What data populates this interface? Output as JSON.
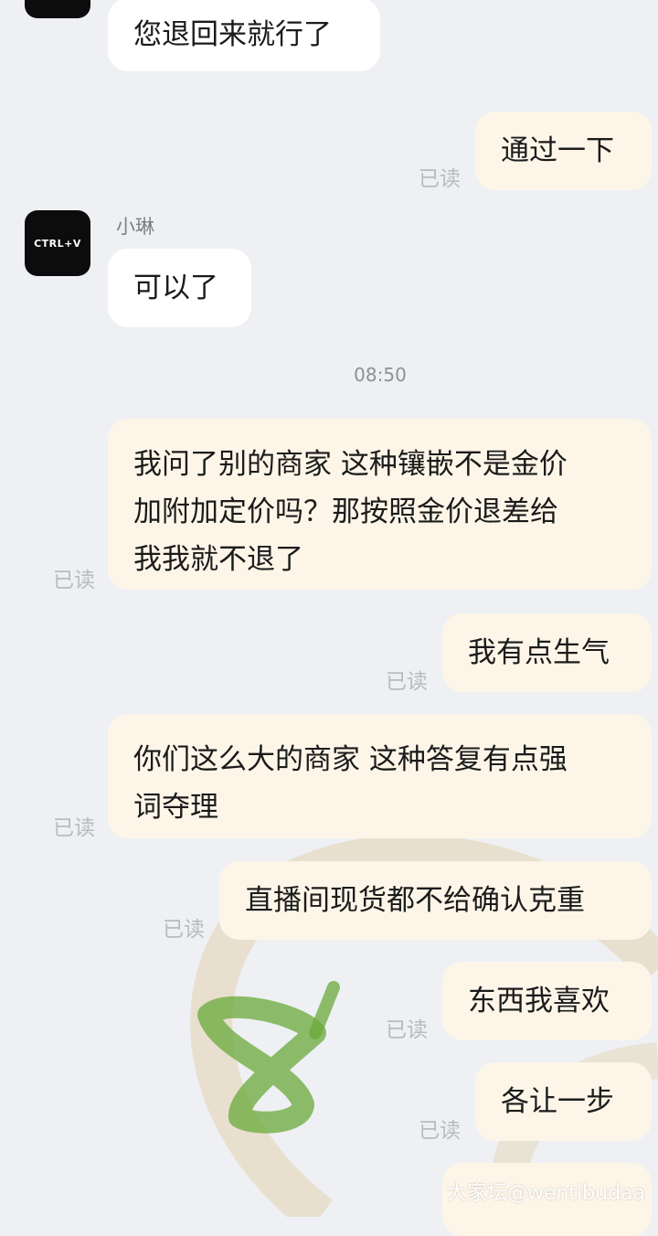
{
  "contact": {
    "name": "小琳",
    "avatar_text": "CTRL+V"
  },
  "timestamp": "08:50",
  "messages": [
    {
      "side": "in",
      "text": "您退回来就行了"
    },
    {
      "side": "out",
      "text": "通过一下",
      "status": "已读"
    },
    {
      "side": "in",
      "text": "可以了"
    },
    {
      "side": "out",
      "lines": [
        "我问了别的商家 这种镶嵌不是金价",
        "加附加定价吗？那按照金价退差给",
        "我我就不退了"
      ],
      "status": "已读"
    },
    {
      "side": "out",
      "text": "我有点生气",
      "status": "已读"
    },
    {
      "side": "out",
      "lines": [
        "你们这么大的商家 这种答复有点强",
        "词夺理"
      ],
      "status": "已读"
    },
    {
      "side": "out",
      "text": "直播间现货都不给确认克重",
      "status": "已读"
    },
    {
      "side": "out",
      "text": "东西我喜欢",
      "status": "已读"
    },
    {
      "side": "out",
      "text": "各让一步",
      "status": "已读"
    }
  ],
  "watermark": "大家坛@wentibudaa",
  "colors": {
    "background": "#eef0f3",
    "incoming_bubble": "#ffffff",
    "outgoing_bubble": "#fdf6e8",
    "read_label": "#b8bbc0",
    "decor_beige": "#e8dcc4",
    "decor_green": "#6aaa3a"
  }
}
